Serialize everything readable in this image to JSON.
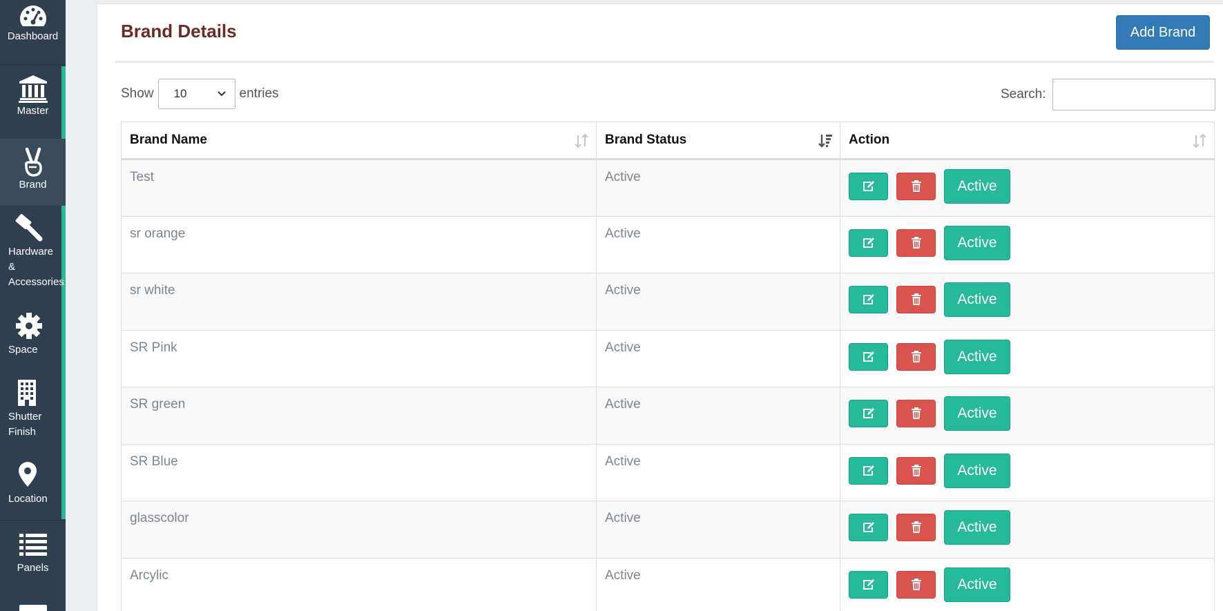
{
  "sidebar": {
    "items": [
      {
        "label": "Dashboard",
        "icon": "dashboard-icon"
      },
      {
        "label": "Master",
        "icon": "bank-icon"
      },
      {
        "label": "Brand",
        "icon": "peace-hand-icon"
      },
      {
        "label": "Hardware\n&\nAccessories",
        "icon": "hammer-icon"
      },
      {
        "label": "Space",
        "icon": "gear-icon"
      },
      {
        "label": "Shutter\nFinish",
        "icon": "building-icon"
      },
      {
        "label": "Location",
        "icon": "map-pin-icon"
      },
      {
        "label": "Panels",
        "icon": "list-icon"
      }
    ]
  },
  "header": {
    "title": "Brand Details",
    "add_button": "Add Brand"
  },
  "controls": {
    "show_label": "Show",
    "entries_value": "10",
    "entries_label": "entries",
    "search_label": "Search:",
    "search_value": ""
  },
  "table": {
    "columns": [
      "Brand Name",
      "Brand Status",
      "Action"
    ],
    "rows": [
      {
        "name": "Test",
        "status": "Active",
        "action": "Active"
      },
      {
        "name": "sr orange",
        "status": "Active",
        "action": "Active"
      },
      {
        "name": "sr white",
        "status": "Active",
        "action": "Active"
      },
      {
        "name": "SR Pink",
        "status": "Active",
        "action": "Active"
      },
      {
        "name": "SR green",
        "status": "Active",
        "action": "Active"
      },
      {
        "name": "SR Blue",
        "status": "Active",
        "action": "Active"
      },
      {
        "name": "glasscolor",
        "status": "Active",
        "action": "Active"
      },
      {
        "name": "Arcylic",
        "status": "Active",
        "action": "Active"
      }
    ]
  },
  "colors": {
    "sidebar": "#2f3f4f",
    "accent_green": "#26b99a",
    "danger_red": "#d9534f",
    "primary_blue": "#337ab7",
    "title": "#6b2a22"
  }
}
